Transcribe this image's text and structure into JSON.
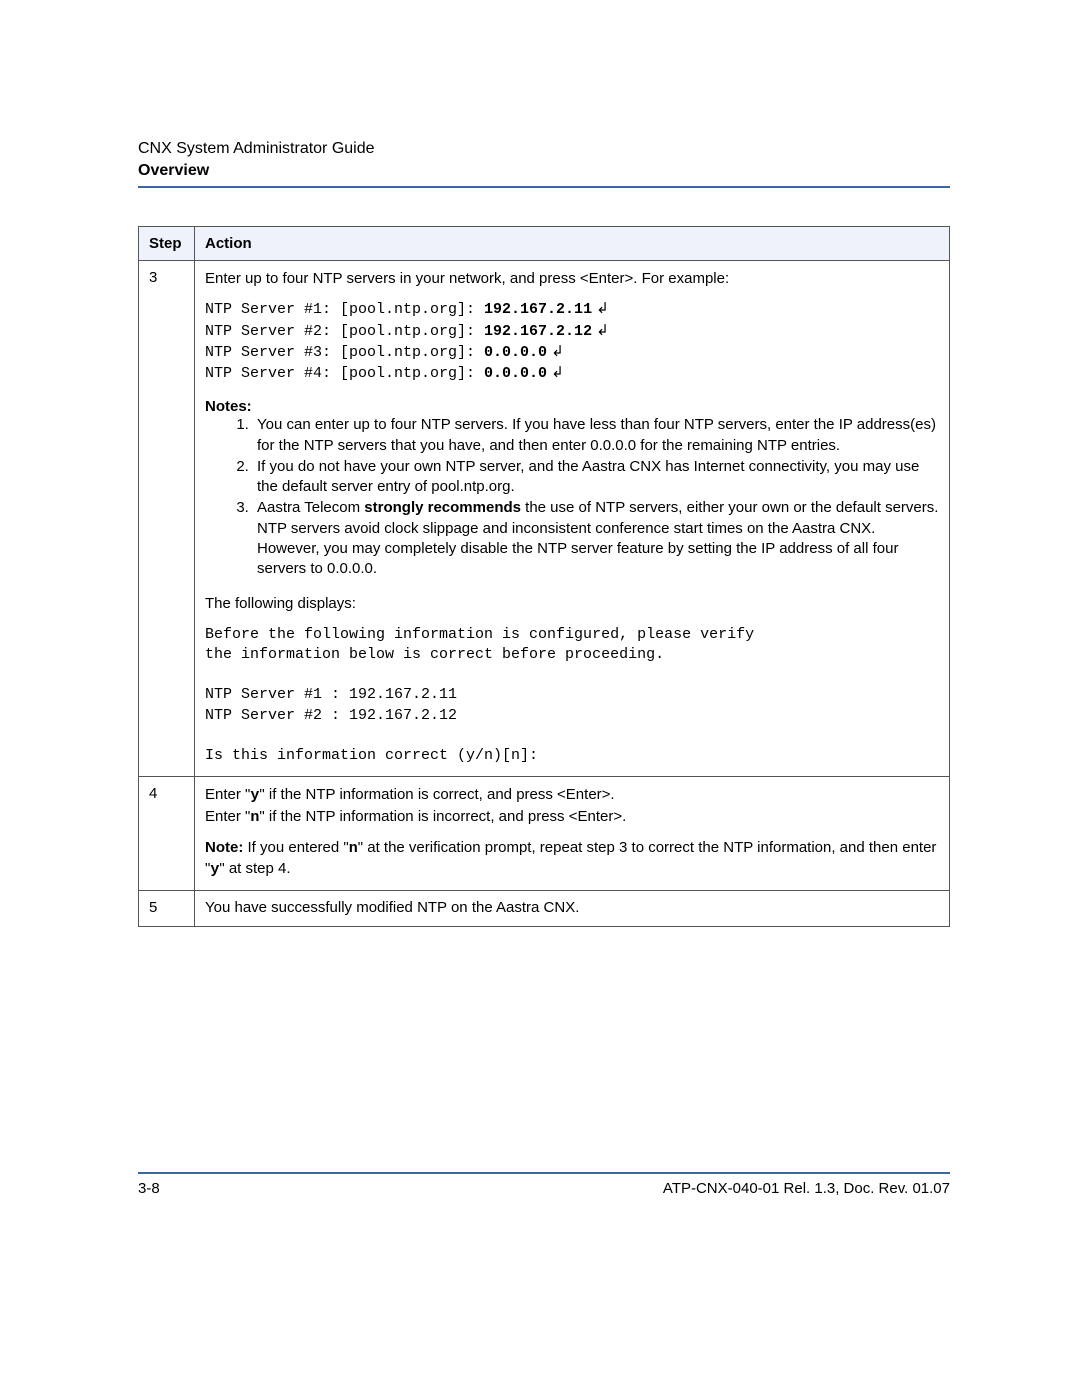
{
  "header": {
    "doc_title": "CNX System Administrator Guide",
    "section": "Overview"
  },
  "table": {
    "head": {
      "step": "Step",
      "action": "Action"
    },
    "rows": {
      "r3": {
        "step": "3",
        "intro": "Enter up to four NTP servers in your network, and press <Enter>. For example:",
        "ntp_lines": {
          "l1a": "NTP Server #1: [pool.ntp.org]: ",
          "l1b": "192.167.2.11",
          "l2a": "NTP Server #2: [pool.ntp.org]: ",
          "l2b": "192.167.2.12",
          "l3a": "NTP Server #3: [pool.ntp.org]: ",
          "l3b": "0.0.0.0",
          "l4a": "NTP Server #4: [pool.ntp.org]: ",
          "l4b": "0.0.0.0"
        },
        "notes_label": "Notes:",
        "notes": {
          "n1": "You can enter up to four NTP servers. If you have less than four NTP servers, enter the IP address(es) for the NTP servers that you have, and then enter 0.0.0.0 for the remaining NTP entries.",
          "n2": "If you do not have your own NTP server, and the Aastra CNX has Internet connectivity, you may use the default server entry of pool.ntp.org.",
          "n3a": "Aastra Telecom ",
          "n3b": "strongly recommends",
          "n3c": " the use of NTP servers, either your own or the default servers.  NTP servers avoid clock slippage and inconsistent conference start times on the Aastra CNX. However, you may completely disable the NTP server feature by setting the IP address of all four servers to 0.0.0.0."
        },
        "following": "The following displays:",
        "verify_block": "Before the following information is configured, please verify\nthe information below is correct before proceeding.\n\nNTP Server #1 : 192.167.2.11\nNTP Server #2 : 192.167.2.12\n\nIs this information correct (y/n)[n]:"
      },
      "r4": {
        "step": "4",
        "l1a": "Enter \"",
        "l1b": "y",
        "l1c": "\" if the NTP information is correct, and press <Enter>.",
        "l2a": "Enter \"",
        "l2b": "n",
        "l2c": "\" if the NTP information is incorrect, and press <Enter>.",
        "note_label": "Note:",
        "note_a": " If you entered \"",
        "note_b": "n",
        "note_c": "\" at the verification prompt, repeat step 3 to correct the NTP information, and then enter \"",
        "note_d": "y",
        "note_e": "\" at step 4."
      },
      "r5": {
        "step": "5",
        "text": "You have successfully modified NTP on the Aastra CNX."
      }
    }
  },
  "footer": {
    "page": "3-8",
    "docref": "ATP-CNX-040-01 Rel. 1.3, Doc. Rev. 01.07"
  },
  "glyph": {
    "enter": " ↲"
  }
}
